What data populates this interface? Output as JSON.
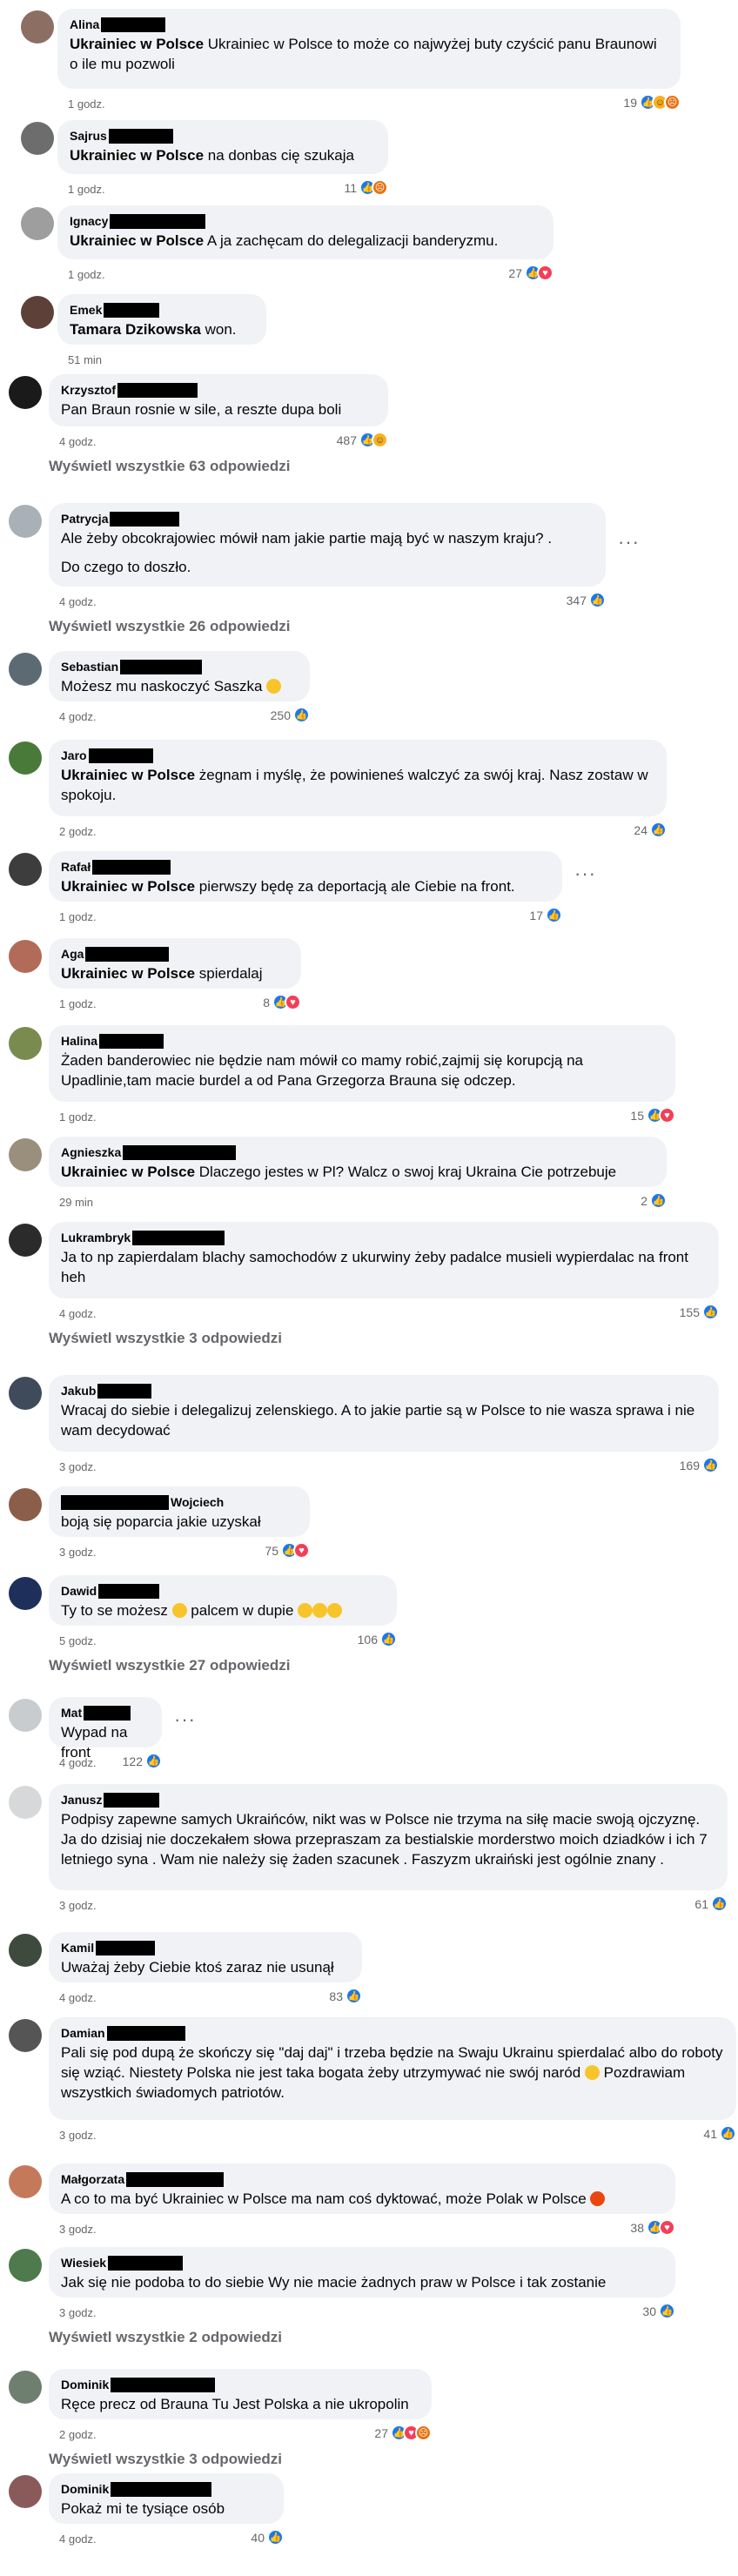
{
  "labels": {
    "view_all_prefix": "Wyświetl wszystkie",
    "view_all_suffix": "odpowiedzi"
  },
  "comments": [
    {
      "name": "Alina",
      "tag": "Ukrainiec w Polsce",
      "text": "Ukrainiec w Polsce to może co najwyżej buty czyścić panu Braunowi o ile mu pozwoli",
      "time": "1 godz.",
      "count": "19",
      "reactions": [
        "like",
        "haha",
        "angry"
      ],
      "view_all": ""
    },
    {
      "name": "Sajrus",
      "tag": "Ukrainiec w Polsce",
      "text": "na donbas cię szukaja",
      "time": "1 godz.",
      "count": "11",
      "reactions": [
        "like",
        "angry"
      ],
      "view_all": ""
    },
    {
      "name": "Ignacy",
      "tag": "Ukrainiec w Polsce",
      "text": "A ja zachęcam do delegalizacji banderyzmu.",
      "time": "1 godz.",
      "count": "27",
      "reactions": [
        "like",
        "love"
      ],
      "view_all": ""
    },
    {
      "name": "Emek",
      "tag": "Tamara Dzikowska",
      "text": "won.",
      "time": "51 min",
      "count": "",
      "reactions": [],
      "view_all": ""
    },
    {
      "name": "Krzysztof",
      "tag": "",
      "text": "Pan Braun rosnie w sile, a reszte dupa boli",
      "time": "4 godz.",
      "count": "487",
      "reactions": [
        "like",
        "haha"
      ],
      "view_all": "63"
    },
    {
      "name": "Patrycja",
      "tag": "",
      "text": "Ale żeby obcokrajowiec mówił nam jakie partie mają być w naszym kraju? .",
      "text2": "Do czego to doszło.",
      "time": "4 godz.",
      "count": "347",
      "reactions": [
        "like"
      ],
      "view_all": "26"
    },
    {
      "name": "Sebastian",
      "tag": "",
      "text": "Możesz mu naskoczyć Saszka",
      "time": "4 godz.",
      "count": "250",
      "reactions": [
        "like"
      ],
      "view_all": ""
    },
    {
      "name": "Jaro",
      "tag": "Ukrainiec w Polsce",
      "text": "żegnam i myślę, że powinieneś walczyć za swój kraj. Nasz zostaw w spokoju.",
      "time": "2 godz.",
      "count": "24",
      "reactions": [
        "like"
      ],
      "view_all": ""
    },
    {
      "name": "Rafał",
      "tag": "Ukrainiec w Polsce",
      "text": "pierwszy będę za deportacją ale Ciebie na front.",
      "time": "1 godz.",
      "count": "17",
      "reactions": [
        "like"
      ],
      "view_all": ""
    },
    {
      "name": "Aga",
      "tag": "Ukrainiec w Polsce",
      "text": "spierdalaj",
      "time": "1 godz.",
      "count": "8",
      "reactions": [
        "like",
        "love"
      ],
      "view_all": ""
    },
    {
      "name": "Halina",
      "tag": "",
      "text": "Żaden banderowiec nie będzie nam mówił co mamy robić,zajmij się korupcją na Upadlinie,tam macie burdel a od Pana Grzegorza Brauna się odczep.",
      "time": "1 godz.",
      "count": "15",
      "reactions": [
        "like",
        "love"
      ],
      "view_all": ""
    },
    {
      "name": "Agnieszka",
      "tag": "Ukrainiec w Polsce",
      "text": "Dlaczego jestes w Pl? Walcz o swoj kraj Ukraina Cie potrzebuje",
      "time": "29 min",
      "count": "2",
      "reactions": [
        "like"
      ],
      "view_all": ""
    },
    {
      "name": "Lukrambryk",
      "tag": "",
      "text": "Ja to np zapierdalam blachy samochodów z ukurwiny żeby padalce musieli wypierdalac na front heh",
      "time": "4 godz.",
      "count": "155",
      "reactions": [
        "like"
      ],
      "view_all": "3"
    },
    {
      "name": "Jakub",
      "tag": "",
      "text": "Wracaj do siebie i delegalizuj zelenskiego. A to jakie partie są w Polsce to nie wasza sprawa i nie wam decydować",
      "time": "3 godz.",
      "count": "169",
      "reactions": [
        "like"
      ],
      "view_all": ""
    },
    {
      "name": "Wojciech",
      "tag": "",
      "text": "boją się poparcia jakie uzyskał",
      "time": "3 godz.",
      "count": "75",
      "reactions": [
        "like",
        "love"
      ],
      "view_all": ""
    },
    {
      "name": "Dawid",
      "tag": "",
      "text": "Ty to se możesz",
      "text_mid": "palcem w dupie",
      "time": "5 godz.",
      "count": "106",
      "reactions": [
        "like"
      ],
      "view_all": "27"
    },
    {
      "name": "Mat",
      "tag": "",
      "text": "Wypad na front",
      "time": "4 godz.",
      "count": "122",
      "reactions": [
        "like"
      ],
      "view_all": ""
    },
    {
      "name": "Janusz",
      "tag": "",
      "text": "Podpisy zapewne samych Ukraińców, nikt was w Polsce nie trzyma na siłę macie swoją ojczyznę. Ja do dzisiaj nie doczekałem słowa przepraszam za bestialskie morderstwo moich dziadków i ich 7 letniego syna . Wam nie należy się żaden szacunek . Faszyzm ukraiński jest ogólnie znany .",
      "time": "3 godz.",
      "count": "61",
      "reactions": [
        "like"
      ],
      "view_all": ""
    },
    {
      "name": "Kamil",
      "tag": "",
      "text": "Uważaj żeby Ciebie ktoś zaraz nie usunął",
      "time": "4 godz.",
      "count": "83",
      "reactions": [
        "like"
      ],
      "view_all": ""
    },
    {
      "name": "Damian",
      "tag": "",
      "text": "Pali się pod dupą że skończy się \"daj daj\" i trzeba będzie na Swaju Ukrainu spierdalać albo do roboty się wziąć. Niestety Polska nie jest taka bogata żeby utrzymywać nie swój naród",
      "text_end": "Pozdrawiam wszystkich świadomych patriotów.",
      "time": "3 godz.",
      "count": "41",
      "reactions": [
        "like"
      ],
      "view_all": ""
    },
    {
      "name": "Małgorzata",
      "tag": "",
      "text": "A co to ma być Ukrainiec w Polsce ma nam coś dyktować, może Polak w Polsce",
      "time": "3 godz.",
      "count": "38",
      "reactions": [
        "like",
        "love"
      ],
      "view_all": ""
    },
    {
      "name": "Wiesiek",
      "tag": "",
      "text": "Jak się nie podoba to do siebie Wy nie macie żadnych praw w Polsce i tak zostanie",
      "time": "3 godz.",
      "count": "30",
      "reactions": [
        "like"
      ],
      "view_all": "2"
    },
    {
      "name": "Dominik",
      "tag": "",
      "text": "Ręce precz od Brauna Tu Jest Polska a nie ukropolin",
      "time": "2 godz.",
      "count": "27",
      "reactions": [
        "like",
        "love",
        "angry"
      ],
      "view_all": "3"
    },
    {
      "name": "Dominik",
      "tag": "",
      "text": "Pokaż mi te tysiące osób",
      "time": "4 godz.",
      "count": "40",
      "reactions": [
        "like"
      ],
      "view_all": ""
    }
  ]
}
